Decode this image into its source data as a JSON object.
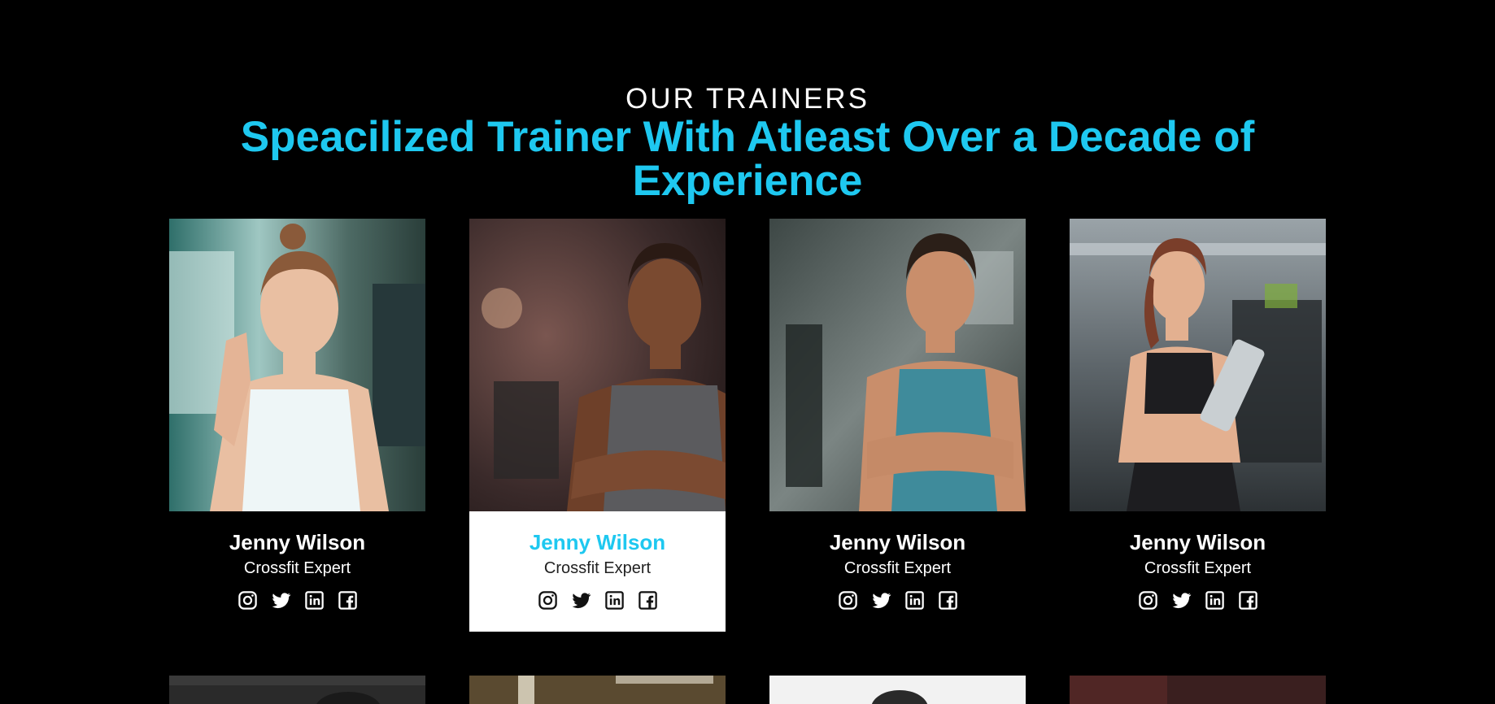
{
  "section": {
    "eyebrow": "OUR TRAINERS",
    "heading": "Speacilized Trainer With Atleast Over a Decade of Experience"
  },
  "trainers": [
    {
      "name": "Jenny Wilson",
      "role": "Crossfit Expert",
      "photo": "trainer-photo-woman-thumbs-up"
    },
    {
      "name": "Jenny Wilson",
      "role": "Crossfit Expert",
      "photo": "trainer-photo-man-arms-crossed"
    },
    {
      "name": "Jenny Wilson",
      "role": "Crossfit Expert",
      "photo": "trainer-photo-man-blue-tank"
    },
    {
      "name": "Jenny Wilson",
      "role": "Crossfit Expert",
      "photo": "trainer-photo-woman-clipboard"
    }
  ],
  "socials": [
    "instagram-icon",
    "twitter-icon",
    "linkedin-icon",
    "facebook-icon"
  ],
  "colors": {
    "background": "#000000",
    "accent": "#1ec8f0",
    "card_active_bg": "#ffffff"
  }
}
